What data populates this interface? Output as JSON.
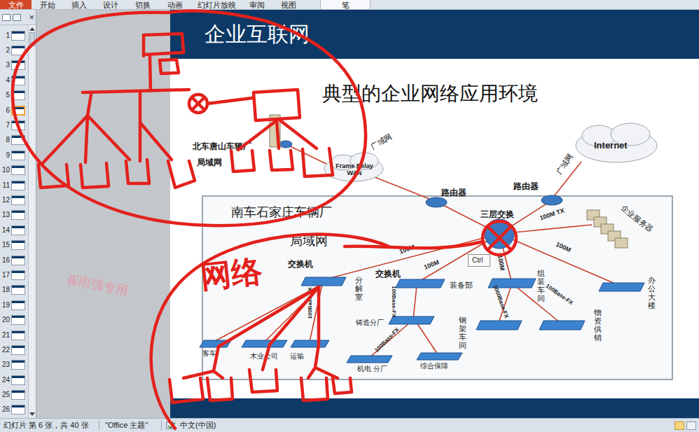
{
  "ribbon_tabs": [
    {
      "label": "文件",
      "kind": "file",
      "selected": false
    },
    {
      "label": "开始",
      "kind": "tab",
      "selected": false
    },
    {
      "label": "插入",
      "kind": "tab",
      "selected": false
    },
    {
      "label": "设计",
      "kind": "tab",
      "selected": false
    },
    {
      "label": "切换",
      "kind": "tab",
      "selected": false
    },
    {
      "label": "动画",
      "kind": "tab",
      "selected": false
    },
    {
      "label": "幻灯片放映",
      "kind": "tab",
      "selected": false
    },
    {
      "label": "审阅",
      "kind": "tab",
      "selected": false
    },
    {
      "label": "视图",
      "kind": "tab",
      "selected": false
    },
    {
      "label": "笔",
      "kind": "tab",
      "selected": true
    }
  ],
  "thumbnail_pane": {
    "close": "×",
    "items": [
      {
        "number": "1",
        "selected": false
      },
      {
        "number": "2",
        "selected": false
      },
      {
        "number": "3",
        "selected": false
      },
      {
        "number": "4",
        "selected": false
      },
      {
        "number": "5",
        "selected": false
      },
      {
        "number": "6",
        "selected": true
      },
      {
        "number": "7",
        "selected": false
      },
      {
        "number": "8",
        "selected": false
      },
      {
        "number": "9",
        "selected": false
      },
      {
        "number": "10",
        "selected": false
      },
      {
        "number": "11",
        "selected": false
      },
      {
        "number": "12",
        "selected": false
      },
      {
        "number": "13",
        "selected": false
      },
      {
        "number": "14",
        "selected": false
      },
      {
        "number": "15",
        "selected": false
      },
      {
        "number": "16",
        "selected": false
      },
      {
        "number": "17",
        "selected": false
      },
      {
        "number": "18",
        "selected": false
      },
      {
        "number": "19",
        "selected": false
      },
      {
        "number": "20",
        "selected": false
      },
      {
        "number": "21",
        "selected": false
      },
      {
        "number": "22",
        "selected": false
      },
      {
        "number": "23",
        "selected": false
      },
      {
        "number": "24",
        "selected": false
      },
      {
        "number": "25",
        "selected": false
      },
      {
        "number": "26",
        "selected": false
      }
    ]
  },
  "watermark": "崔雨强专用",
  "slide": {
    "title": "企业互联网",
    "subtitle": "典型的企业网络应用环境",
    "diagram": {
      "labels": [
        {
          "text": "北车唐山车辆厂",
          "kind": "horizontal"
        },
        {
          "text": "局域网",
          "kind": "horizontal"
        },
        {
          "text": "广域网",
          "kind": "horizontal"
        },
        {
          "text": "Frame Relay WAN",
          "kind": "horizontal"
        },
        {
          "text": "路由器",
          "kind": "horizontal"
        },
        {
          "text": "路由器",
          "kind": "horizontal"
        },
        {
          "text": "广域网",
          "kind": "horizontal"
        },
        {
          "text": "Internet",
          "kind": "horizontal"
        },
        {
          "text": "南车石家庄车辆厂",
          "kind": "horizontal"
        },
        {
          "text": "局域网",
          "kind": "horizontal"
        },
        {
          "text": "三层交换",
          "kind": "horizontal"
        },
        {
          "text": "100M TX",
          "kind": "horizontal"
        },
        {
          "text": "企业服务器",
          "kind": "horizontal"
        },
        {
          "text": "100M",
          "kind": "horizontal"
        },
        {
          "text": "100M",
          "kind": "horizontal"
        },
        {
          "text": "100M",
          "kind": "horizontal"
        },
        {
          "text": "100M",
          "kind": "horizontal"
        },
        {
          "text": "交换机",
          "kind": "horizontal"
        },
        {
          "text": "交换机",
          "kind": "horizontal"
        },
        {
          "text": "分解室",
          "kind": "vertical"
        },
        {
          "text": "装备部",
          "kind": "horizontal"
        },
        {
          "text": "组装车间",
          "kind": "vertical"
        },
        {
          "text": "100Base-FX",
          "kind": "horizontal"
        },
        {
          "text": "办公大楼",
          "kind": "vertical"
        },
        {
          "text": "铸造分厂",
          "kind": "horizontal"
        },
        {
          "text": "钢架车间",
          "kind": "vertical"
        },
        {
          "text": "物资供销",
          "kind": "vertical"
        },
        {
          "text": "1000Base-FX",
          "kind": "horizontal"
        },
        {
          "text": "100Base-FX",
          "kind": "horizontal"
        },
        {
          "text": "100Base-FX",
          "kind": "horizontal"
        },
        {
          "text": "100Base-FX",
          "kind": "horizontal"
        },
        {
          "text": "木业公司",
          "kind": "horizontal"
        },
        {
          "text": "运输",
          "kind": "horizontal"
        },
        {
          "text": "机电 分厂",
          "kind": "horizontal"
        },
        {
          "text": "综合保障",
          "kind": "horizontal"
        },
        {
          "text": "客车",
          "kind": "horizontal"
        }
      ]
    }
  },
  "annotation": {
    "text": "网络"
  },
  "tooltip": "Ctrl",
  "status_bar": {
    "slide_info": "幻灯片 第 6 张，共 40 张",
    "theme": "\"Office 主题\"",
    "language": "中文(中国)"
  }
}
